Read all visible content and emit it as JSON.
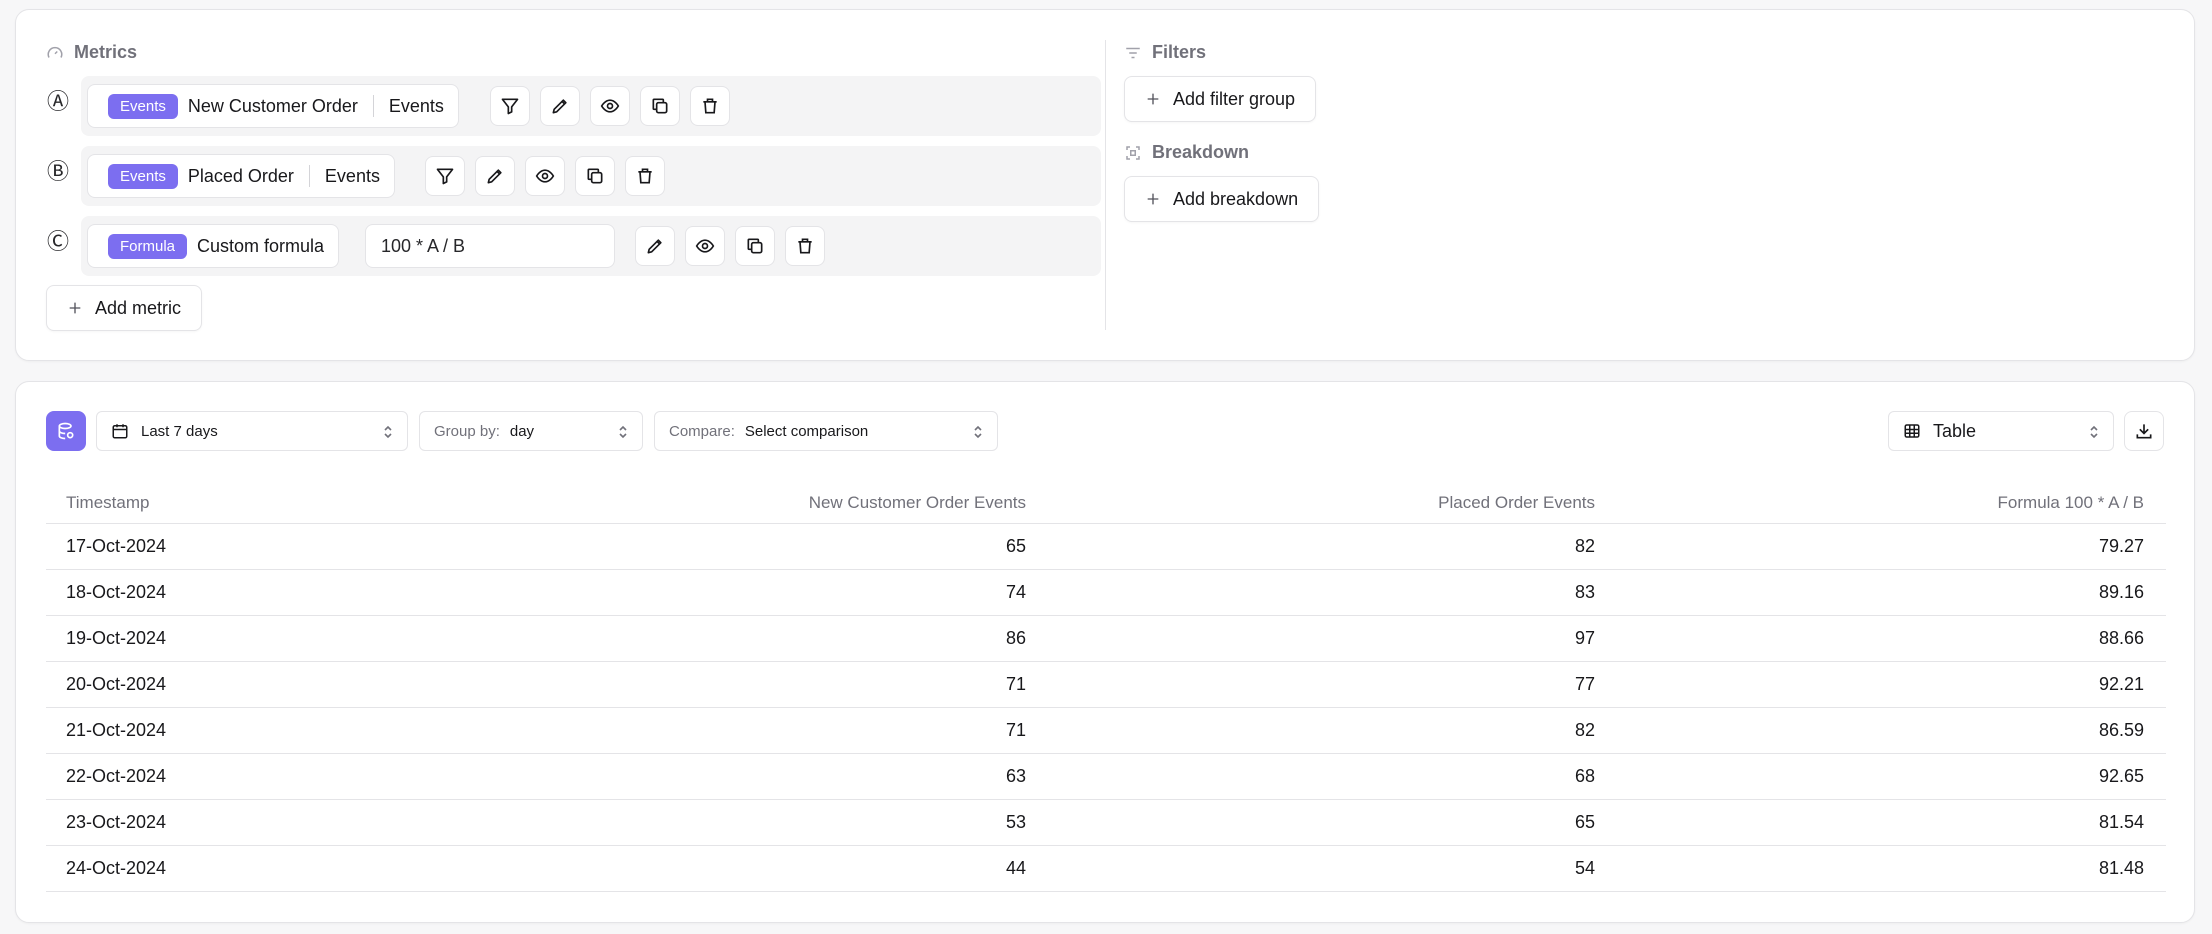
{
  "metrics": {
    "title": "Metrics",
    "rows": [
      {
        "letter": "Ⓐ",
        "badge": "Events",
        "name": "New Customer Order",
        "type": "Events"
      },
      {
        "letter": "Ⓑ",
        "badge": "Events",
        "name": "Placed Order",
        "type": "Events"
      },
      {
        "letter": "Ⓒ",
        "badge": "Formula",
        "name": "Custom formula",
        "formula": "100 * A / B"
      }
    ],
    "add_label": "Add metric"
  },
  "filters": {
    "title": "Filters",
    "add_label": "Add filter group"
  },
  "breakdown": {
    "title": "Breakdown",
    "add_label": "Add breakdown"
  },
  "toolbar": {
    "date_range": "Last 7 days",
    "group_by_label": "Group by:",
    "group_by_value": "day",
    "compare_label": "Compare:",
    "compare_value": "Select comparison",
    "view": "Table"
  },
  "table": {
    "columns": [
      "Timestamp",
      "New Customer Order Events",
      "Placed Order Events",
      "Formula 100 * A / B"
    ],
    "rows": [
      [
        "17-Oct-2024",
        "65",
        "82",
        "79.27"
      ],
      [
        "18-Oct-2024",
        "74",
        "83",
        "89.16"
      ],
      [
        "19-Oct-2024",
        "86",
        "97",
        "88.66"
      ],
      [
        "20-Oct-2024",
        "71",
        "77",
        "92.21"
      ],
      [
        "21-Oct-2024",
        "71",
        "82",
        "86.59"
      ],
      [
        "22-Oct-2024",
        "63",
        "68",
        "92.65"
      ],
      [
        "23-Oct-2024",
        "53",
        "65",
        "81.54"
      ],
      [
        "24-Oct-2024",
        "44",
        "54",
        "81.48"
      ]
    ]
  },
  "colors": {
    "accent": "#7c6ef0",
    "border": "#e4e4e7",
    "muted": "#71717a"
  }
}
